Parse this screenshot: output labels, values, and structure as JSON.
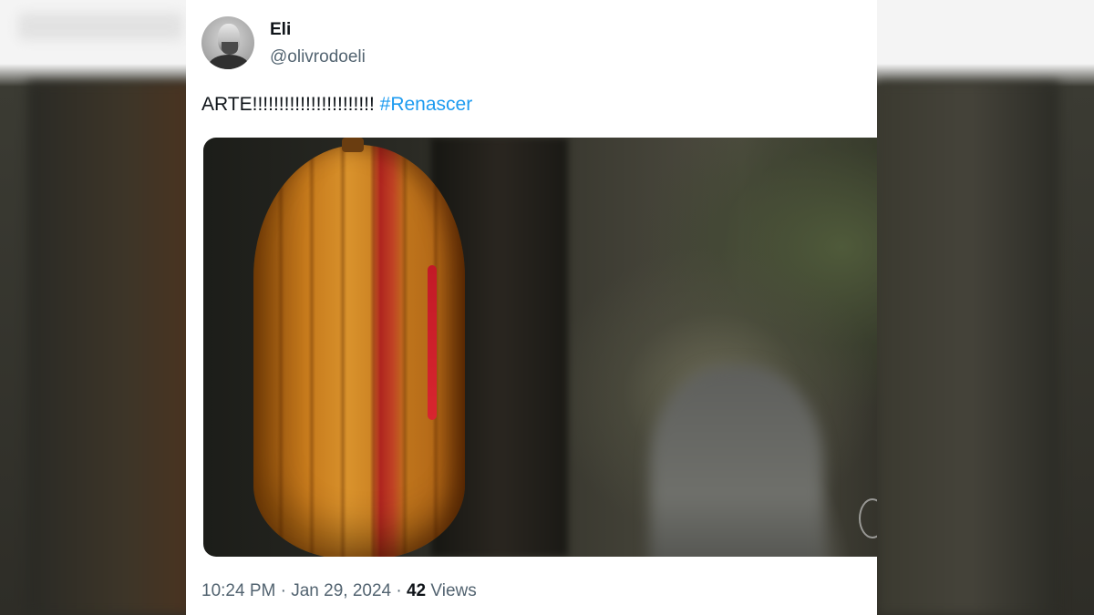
{
  "tweet": {
    "author": {
      "name": "Eli",
      "handle": "@olivrodoeli"
    },
    "text": "ARTE!!!!!!!!!!!!!!!!!!!!!!! ",
    "hashtag": "#Renascer",
    "media": {
      "description_icon": "image-icon"
    },
    "meta": {
      "time": "10:24 PM",
      "separator1": " · ",
      "date": "Jan 29, 2024",
      "separator2": " · ",
      "views_count": "42",
      "views_label": " Views"
    }
  },
  "colors": {
    "hashtag": "#1d9bf0",
    "secondary_text": "#536471",
    "primary_text": "#0f1419"
  }
}
